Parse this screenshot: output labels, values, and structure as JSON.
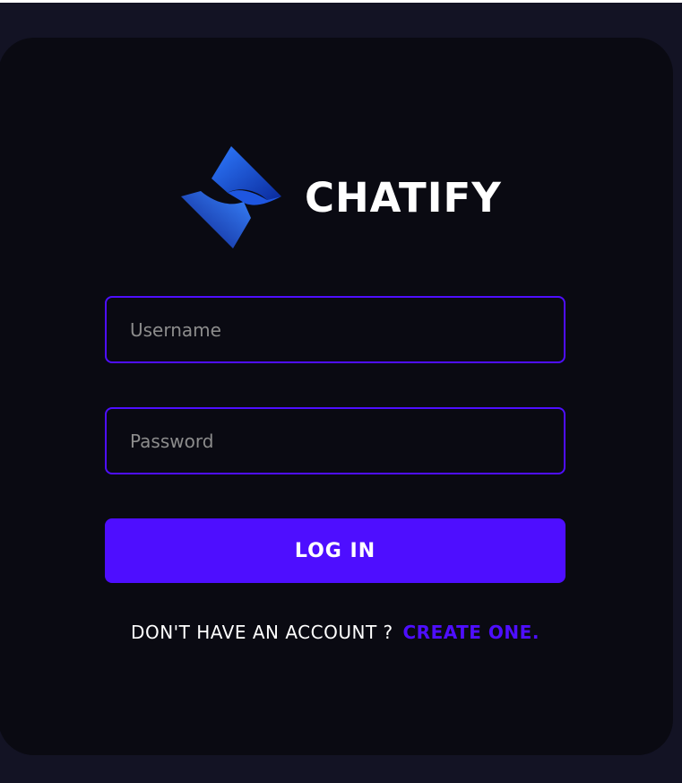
{
  "brand": {
    "name": "CHATIFY",
    "logo_icon": "chatify-logo-icon"
  },
  "form": {
    "username": {
      "placeholder": "Username",
      "value": ""
    },
    "password": {
      "placeholder": "Password",
      "value": ""
    },
    "submit_label": "LOG IN"
  },
  "signup": {
    "prompt": "DON'T HAVE AN ACCOUNT ?",
    "link_label": "CREATE ONE."
  },
  "colors": {
    "page_background": "#131324",
    "card_background": "#0a0a12",
    "accent": "#4e0eff",
    "text": "#ffffff",
    "placeholder": "#8c8c8c"
  }
}
